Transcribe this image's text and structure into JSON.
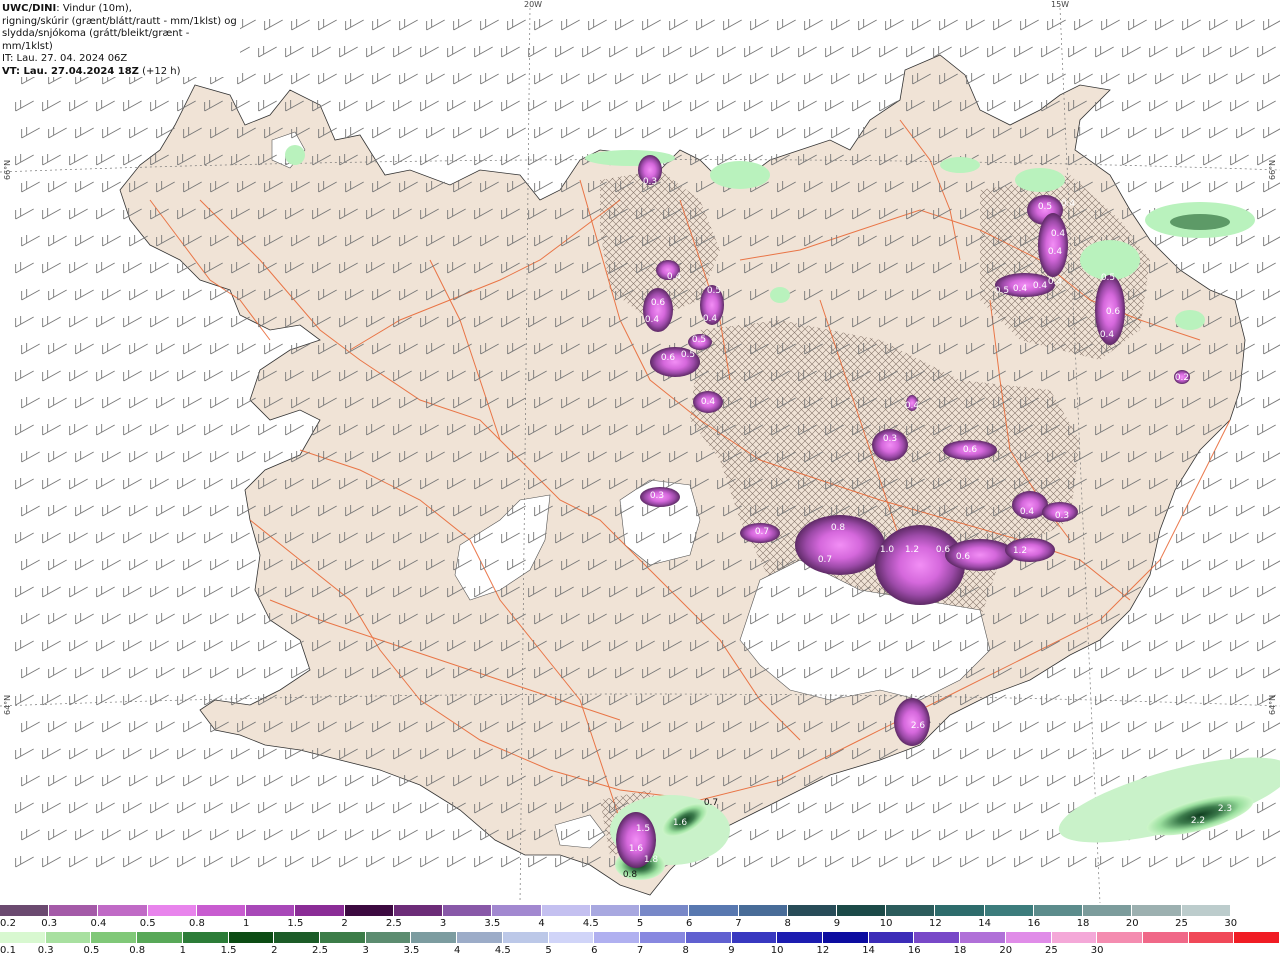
{
  "legend": {
    "model": "UWC/DINI",
    "line1_rest": ": Vindur (10m),",
    "line2": "rigning/skúrir (grænt/blátt/rautt - mm/1klst) og",
    "line3": "slydda/snjókoma (grátt/bleikt/grænt - mm/1klst)",
    "line4": "IT: Lau. 27. 04. 2024 06Z",
    "line5_bold": "VT: Lau. 27.04.2024 18Z",
    "line5_rest": " (+12 h)"
  },
  "grid_labels": {
    "lon_20w": "20W",
    "lon_15w": "15W",
    "lat_66n_left": "66°N",
    "lat_66n_right": "66°N",
    "lat_64n_left": "64°N",
    "lat_64n_right": "64°N"
  },
  "colors": {
    "land": "#f0e3d6",
    "roads": "#e8622e",
    "glacier": "#ffffff",
    "purple_dark": "#6a2f77",
    "purple_mid": "#a64cb4",
    "purple_light": "#e06ee6",
    "green_light": "#b9f2bd",
    "green_dark": "#2c6b3c"
  },
  "precip_labels": [
    {
      "text": "0.3",
      "pos": "nw-fjords"
    },
    {
      "text": "0.4"
    },
    {
      "text": "0.5"
    },
    {
      "text": "0.6"
    },
    {
      "text": "0.4"
    },
    {
      "text": "0.4"
    },
    {
      "text": "0.6"
    },
    {
      "text": "0.5"
    },
    {
      "text": "0.5"
    },
    {
      "text": "0.4"
    },
    {
      "text": "0.5"
    },
    {
      "text": "0.4"
    },
    {
      "text": "0.4"
    },
    {
      "text": "0.4"
    },
    {
      "text": "0.4"
    },
    {
      "text": "0.5"
    },
    {
      "text": "0.4"
    },
    {
      "text": "0.4"
    },
    {
      "text": "0.5"
    },
    {
      "text": "0.6"
    },
    {
      "text": "0.4"
    },
    {
      "text": "0.4"
    },
    {
      "text": "0.3"
    },
    {
      "text": "0.6"
    },
    {
      "text": "0.3"
    },
    {
      "text": "0.4"
    },
    {
      "text": "0.3"
    },
    {
      "text": "0.7"
    },
    {
      "text": "0.8"
    },
    {
      "text": "0.7"
    },
    {
      "text": "1.0"
    },
    {
      "text": "1.2"
    },
    {
      "text": "0.6"
    },
    {
      "text": "0.6"
    },
    {
      "text": "1.2"
    },
    {
      "text": "2.6"
    },
    {
      "text": "0.7"
    },
    {
      "text": "1.5"
    },
    {
      "text": "1.6"
    },
    {
      "text": "1.6"
    },
    {
      "text": "1.8"
    },
    {
      "text": "0.8"
    },
    {
      "text": "2.2"
    },
    {
      "text": "2.3"
    },
    {
      "text": "0.2"
    }
  ],
  "colorbar_snow": {
    "colors": [
      "#6b4a70",
      "#a45aa8",
      "#c06ac6",
      "#e884ec",
      "#c85cd0",
      "#a848b8",
      "#8a2c96",
      "#3c0a40",
      "#6c2c78",
      "#8858a8",
      "#a288d0",
      "#c4c0f0",
      "#a8a8e0",
      "#7888c8",
      "#5878b0",
      "#486c98",
      "#284c58",
      "#1c4a48",
      "#2c5c5c",
      "#2e6c6c",
      "#3c7c7c",
      "#5c8c8c",
      "#7c9c9c",
      "#9cb0b0",
      "#bccccc",
      "#ffffff"
    ],
    "ticks": [
      "0.2",
      "0.3",
      "0.4",
      "0.5",
      "0.8",
      "1",
      "1.5",
      "2",
      "2.5",
      "3",
      "3.5",
      "4",
      "4.5",
      "5",
      "6",
      "7",
      "8",
      "9",
      "10",
      "12",
      "14",
      "16",
      "18",
      "20",
      "25",
      "30"
    ]
  },
  "colorbar_rain": {
    "colors": [
      "#d8f8d0",
      "#a8e0a0",
      "#80c878",
      "#58a858",
      "#2c7c38",
      "#0c4c14",
      "#1c5c28",
      "#3c7c48",
      "#5c8c70",
      "#7c9ca0",
      "#9cacc8",
      "#bcc8e8",
      "#d0d4f8",
      "#b0b0f0",
      "#8888e0",
      "#6060d0",
      "#3838c0",
      "#1c1cb0",
      "#0c0ca0",
      "#3c2cb8",
      "#7848c8",
      "#b070d8",
      "#e08ce8",
      "#f4a8d8",
      "#f48cb0",
      "#f06888",
      "#f04858",
      "#f01c24"
    ],
    "ticks": [
      "0.1",
      "0.3",
      "0.5",
      "0.8",
      "1",
      "1.5",
      "2",
      "2.5",
      "3",
      "3.5",
      "4",
      "4.5",
      "5",
      "6",
      "7",
      "8",
      "9",
      "10",
      "12",
      "14",
      "16",
      "18",
      "20",
      "25",
      "30"
    ]
  }
}
